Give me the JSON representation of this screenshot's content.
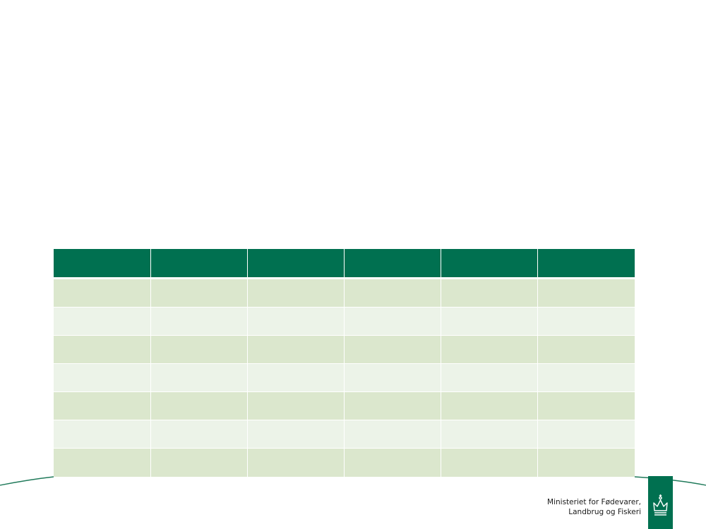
{
  "table": {
    "columns": [
      "",
      "",
      "",
      "",
      "",
      ""
    ],
    "rows": [
      [
        "",
        "",
        "",
        "",
        "",
        ""
      ],
      [
        "",
        "",
        "",
        "",
        "",
        ""
      ],
      [
        "",
        "",
        "",
        "",
        "",
        ""
      ],
      [
        "",
        "",
        "",
        "",
        "",
        ""
      ],
      [
        "",
        "",
        "",
        "",
        "",
        ""
      ],
      [
        "",
        "",
        "",
        "",
        "",
        ""
      ],
      [
        "",
        "",
        "",
        "",
        "",
        ""
      ]
    ]
  },
  "footer": {
    "ministry_line1": "Ministeriet for Fødevarer,",
    "ministry_line2": "Landbrug og Fiskeri",
    "logo_icon": "crown-icon",
    "brand_color": "#007050",
    "accent_line_color": "#1f7a5a"
  }
}
